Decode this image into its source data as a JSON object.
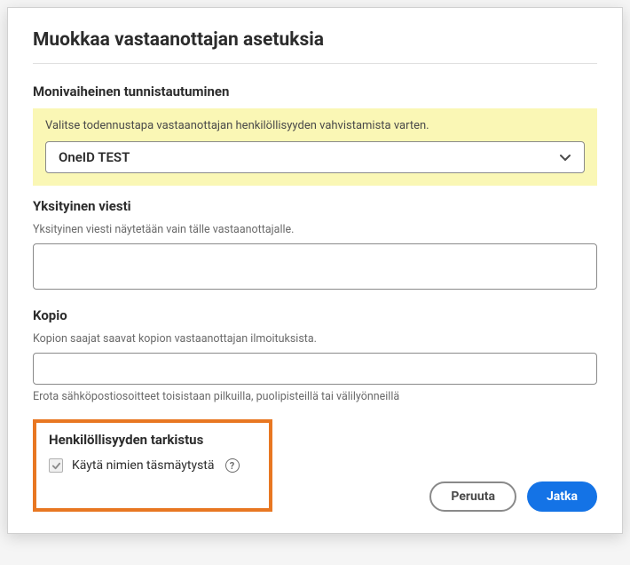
{
  "dialog": {
    "title": "Muokkaa vastaanottajan asetuksia"
  },
  "auth": {
    "heading": "Monivaiheinen tunnistautuminen",
    "helper": "Valitse todennustapa vastaanottajan henkilöllisyyden vahvistamista varten.",
    "selected": "OneID TEST"
  },
  "privateMessage": {
    "heading": "Yksityinen viesti",
    "helper": "Yksityinen viesti näytetään vain tälle vastaanottajalle.",
    "value": ""
  },
  "copy": {
    "heading": "Kopio",
    "helper": "Kopion saajat saavat kopion vastaanottajan ilmoituksista.",
    "value": "",
    "hint": "Erota sähköpostiosoitteet toisistaan pilkuilla, puolipisteillä tai välilyönneillä"
  },
  "identityCheck": {
    "heading": "Henkilöllisyyden tarkistus",
    "checkboxLabel": "Käytä nimien täsmäytystä",
    "checked": true
  },
  "buttons": {
    "cancel": "Peruuta",
    "continue": "Jatka"
  }
}
